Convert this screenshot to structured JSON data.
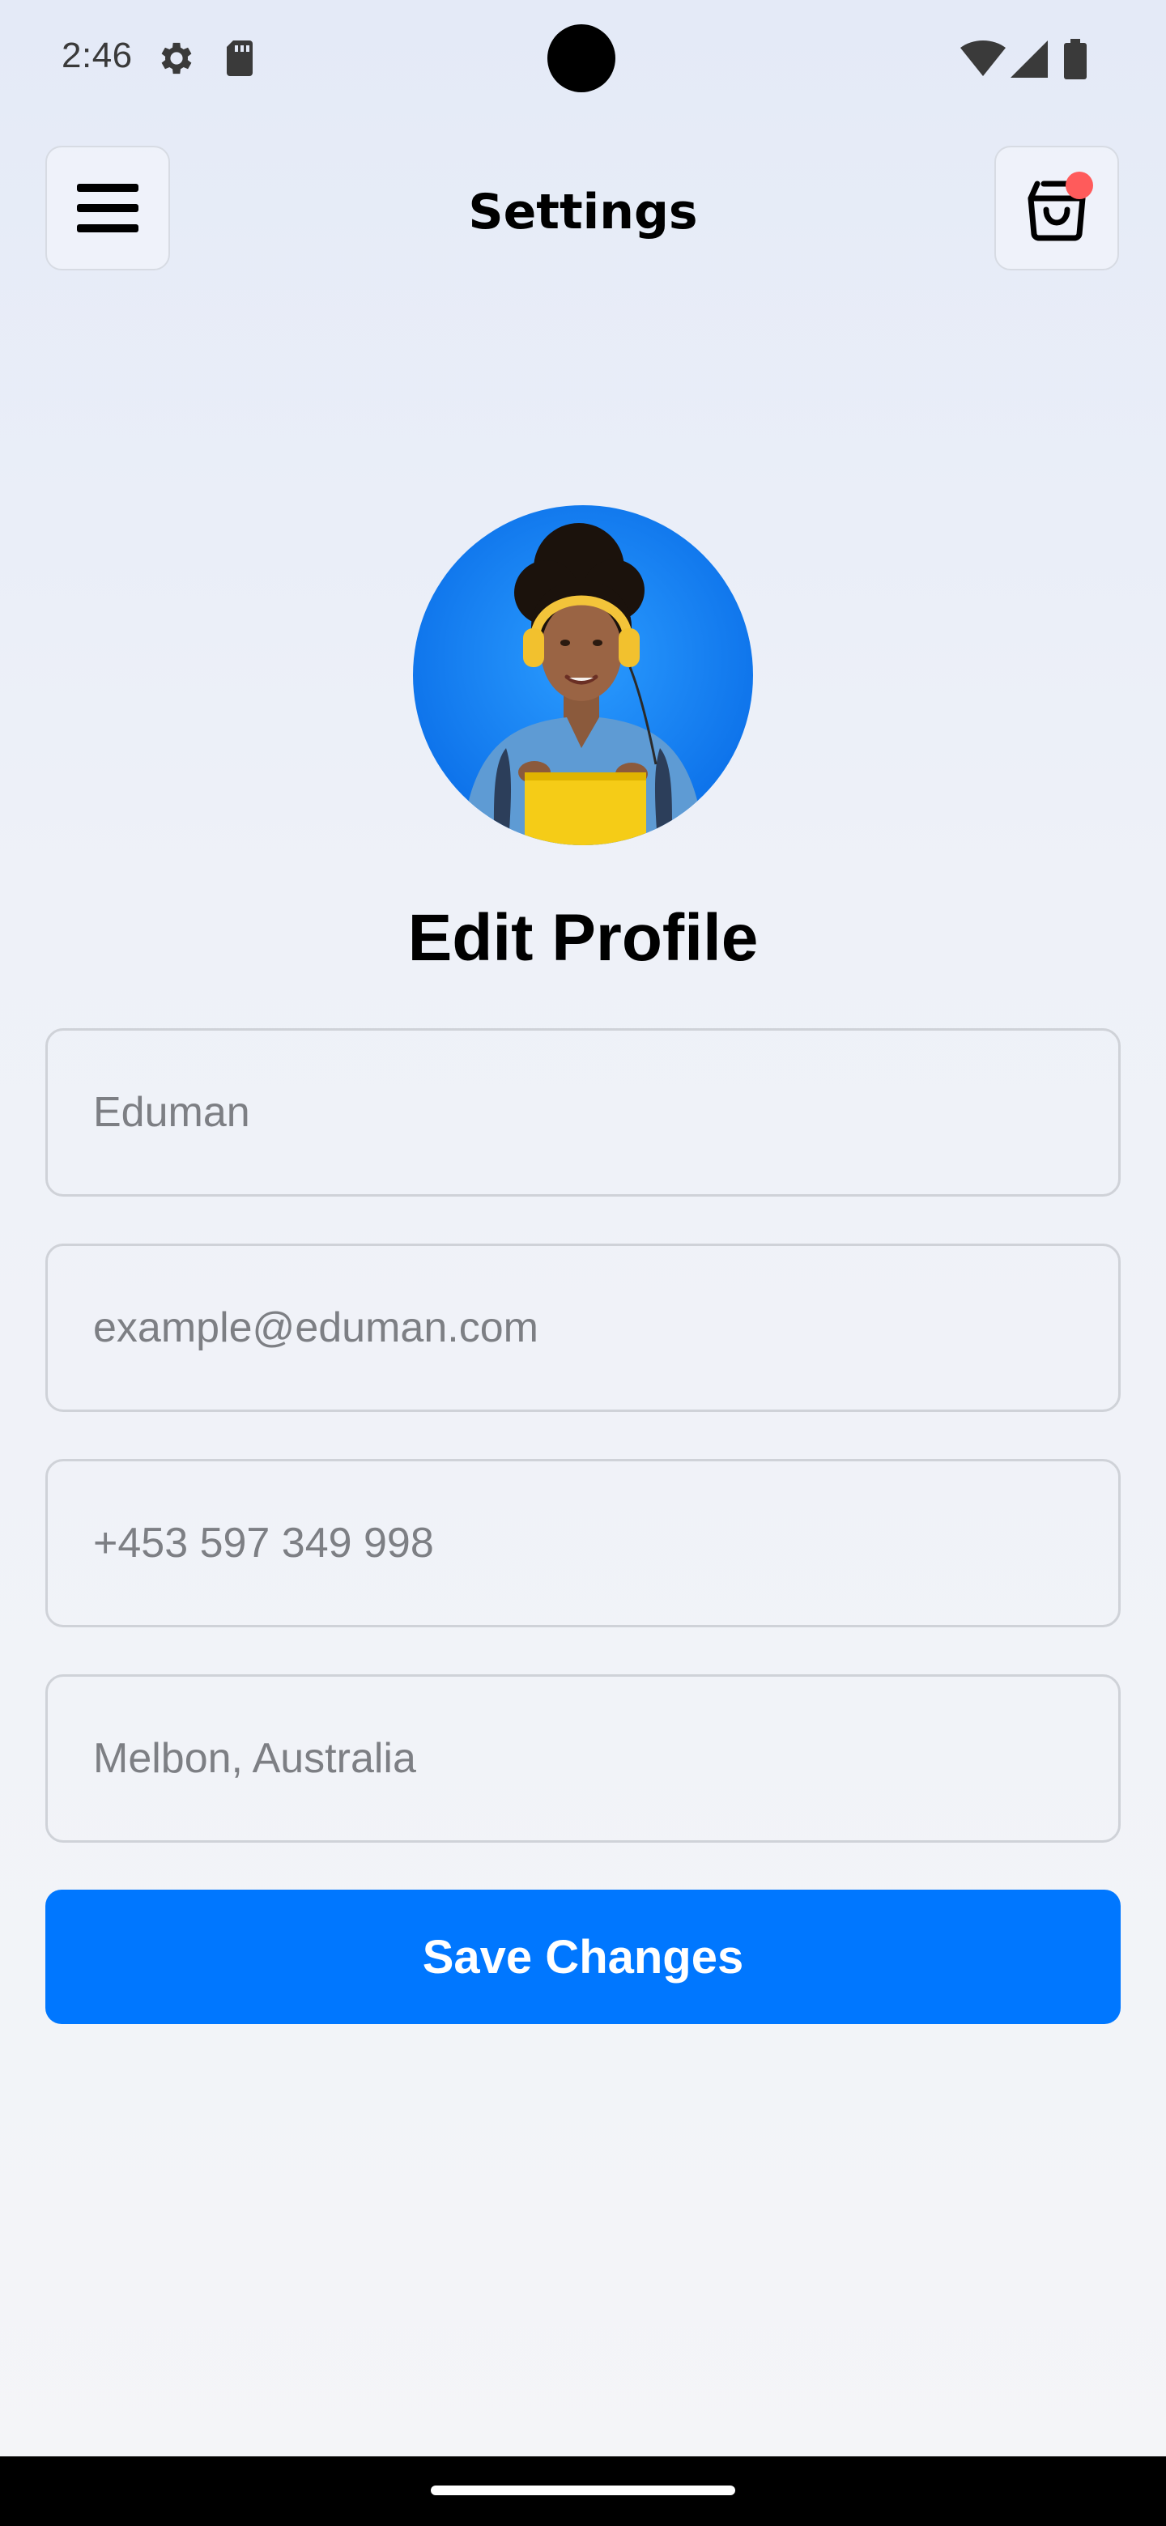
{
  "status_bar": {
    "time": "2:46",
    "icons": [
      "settings-gear-icon",
      "sd-card-icon",
      "wifi-icon",
      "cell-signal-icon",
      "battery-icon"
    ]
  },
  "header": {
    "title": "Settings",
    "menu_icon": "hamburger-menu-icon",
    "cart_icon": "shopping-bag-icon",
    "cart_badge_color": "#ff5b5b"
  },
  "profile": {
    "avatar": "profile-photo",
    "heading": "Edit Profile"
  },
  "form": {
    "name_placeholder": "Eduman",
    "email_placeholder": "example@eduman.com",
    "phone_placeholder": "+453 597 349 998",
    "location_placeholder": "Melbon, Australia",
    "save_label": "Save Changes"
  },
  "colors": {
    "accent": "#0077ff",
    "background_top": "#e4eaf7",
    "background_bottom": "#f4f5f8"
  }
}
